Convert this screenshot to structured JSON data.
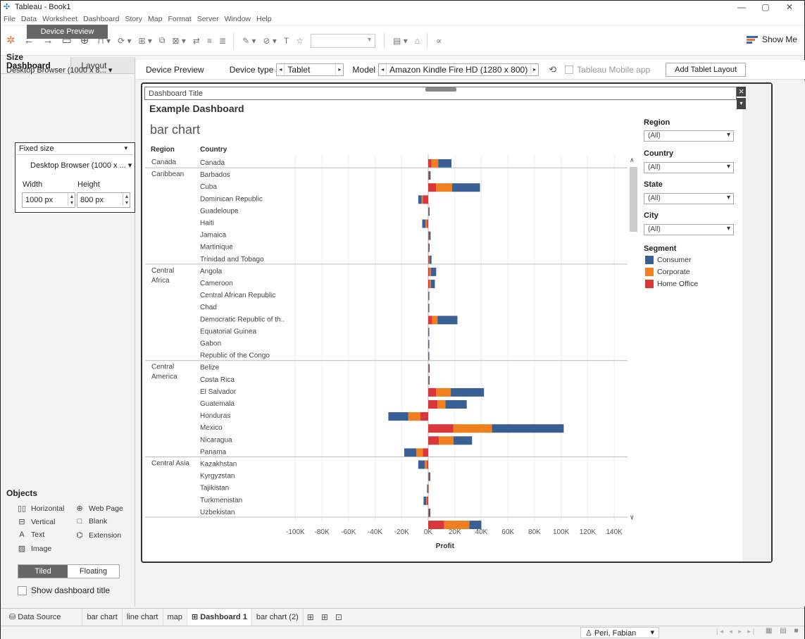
{
  "window": {
    "title": "Tableau - Book1",
    "minimize": "—",
    "restore": "▢",
    "close": "✕"
  },
  "menu": [
    "File",
    "Data",
    "Worksheet",
    "Dashboard",
    "Story",
    "Map",
    "Format",
    "Server",
    "Window",
    "Help"
  ],
  "toolbar": {
    "show_me": "Show Me"
  },
  "left_panel": {
    "tabs": {
      "dashboard": "Dashboard",
      "layout": "Layout"
    },
    "device_preview_button": "Device Preview",
    "size_title": "Size",
    "size_select": "Desktop Browser (1000 x 8... ▾",
    "fixed_size": "Fixed size",
    "desktop_browser": "Desktop Browser (1000 x ... ▾",
    "width_label": "Width",
    "height_label": "Height",
    "width_value": "1000 px",
    "height_value": "800 px",
    "objects_title": "Objects",
    "objects": {
      "horizontal": "Horizontal",
      "web_page": "Web Page",
      "vertical": "Vertical",
      "blank": "Blank",
      "text": "Text",
      "extension": "Extension",
      "image": "Image"
    },
    "tiled": "Tiled",
    "floating": "Floating",
    "show_dashboard_title": "Show dashboard title"
  },
  "device_bar": {
    "device_preview": "Device Preview",
    "device_type_label": "Device type",
    "device_type_value": "Tablet",
    "model_label": "Model",
    "model_value": "Amazon Kindle Fire HD (1280 x 800)",
    "mobile_app": "Tableau Mobile app",
    "add_layout": "Add Tablet Layout"
  },
  "dashboard": {
    "title_object": "Dashboard Title",
    "title": "Example Dashboard",
    "sheet_title": "bar chart",
    "header_region": "Region",
    "header_country": "Country",
    "axis_title": "Profit"
  },
  "filters": {
    "region": {
      "label": "Region",
      "value": "(All)"
    },
    "country": {
      "label": "Country",
      "value": "(All)"
    },
    "state": {
      "label": "State",
      "value": "(All)"
    },
    "city": {
      "label": "City",
      "value": "(All)"
    }
  },
  "legend": {
    "title": "Segment",
    "items": [
      {
        "label": "Consumer",
        "color": "#3a5f94"
      },
      {
        "label": "Corporate",
        "color": "#f0801f"
      },
      {
        "label": "Home Office",
        "color": "#d9373a"
      }
    ]
  },
  "chart_data": {
    "type": "bar",
    "orientation": "horizontal",
    "stacked": true,
    "xlabel": "Profit",
    "xlim": [
      -100000,
      150000
    ],
    "xticks": [
      "-100K",
      "-80K",
      "-60K",
      "-40K",
      "-20K",
      "0K",
      "20K",
      "40K",
      "60K",
      "80K",
      "100K",
      "120K",
      "140K"
    ],
    "series_names": [
      "Home Office",
      "Corporate",
      "Consumer"
    ],
    "colors": {
      "Home Office": "#d9373a",
      "Corporate": "#f0801f",
      "Consumer": "#3a5f94"
    },
    "groups": [
      {
        "region": "Canada",
        "rows": [
          {
            "country": "Canada",
            "values": [
              2500,
              5000,
              10000
            ]
          }
        ]
      },
      {
        "region": "Caribbean",
        "rows": [
          {
            "country": "Barbados",
            "values": [
              300,
              300,
              1200
            ]
          },
          {
            "country": "Cuba",
            "values": [
              6000,
              12000,
              21000
            ]
          },
          {
            "country": "Dominican Republic",
            "values": [
              -4000,
              -1000,
              -2500
            ]
          },
          {
            "country": "Guadeloupe",
            "values": [
              200,
              200,
              500
            ]
          },
          {
            "country": "Haiti",
            "values": [
              -1000,
              -1000,
              -2500
            ]
          },
          {
            "country": "Jamaica",
            "values": [
              300,
              300,
              1200
            ]
          },
          {
            "country": "Martinique",
            "values": [
              200,
              200,
              600
            ]
          },
          {
            "country": "Trinidad and Tobago",
            "values": [
              500,
              500,
              1500
            ]
          }
        ]
      },
      {
        "region": "Central Africa",
        "rows": [
          {
            "country": "Angola",
            "values": [
              1000,
              1000,
              4000
            ]
          },
          {
            "country": "Cameroon",
            "values": [
              1000,
              1000,
              3000
            ]
          },
          {
            "country": "Central African Republic",
            "values": [
              100,
              100,
              300
            ]
          },
          {
            "country": "Chad",
            "values": [
              100,
              100,
              400
            ]
          },
          {
            "country": "Democratic Republic of th..",
            "values": [
              3000,
              4000,
              15000
            ]
          },
          {
            "country": "Equatorial Guinea",
            "values": [
              100,
              100,
              400
            ]
          },
          {
            "country": "Gabon",
            "values": [
              100,
              100,
              400
            ]
          },
          {
            "country": "Republic of the Congo",
            "values": [
              100,
              100,
              500
            ]
          }
        ]
      },
      {
        "region": "Central America",
        "rows": [
          {
            "country": "Belize",
            "values": [
              200,
              300,
              300
            ]
          },
          {
            "country": "Costa Rica",
            "values": [
              200,
              200,
              500
            ]
          },
          {
            "country": "El Salvador",
            "values": [
              6000,
              11000,
              25000
            ]
          },
          {
            "country": "Guatemala",
            "values": [
              7000,
              6000,
              16000
            ]
          },
          {
            "country": "Honduras",
            "values": [
              -6000,
              -9000,
              -15000
            ]
          },
          {
            "country": "Mexico",
            "values": [
              19000,
              29000,
              54000
            ]
          },
          {
            "country": "Nicaragua",
            "values": [
              8000,
              11000,
              14000
            ]
          },
          {
            "country": "Panama",
            "values": [
              -4000,
              -5000,
              -9000
            ]
          }
        ]
      },
      {
        "region": "Central Asia",
        "rows": [
          {
            "country": "Kazakhstan",
            "values": [
              -1000,
              -1500,
              -5000
            ]
          },
          {
            "country": "Kyrgyzstan",
            "values": [
              300,
              300,
              1000
            ]
          },
          {
            "country": "Tajikistan",
            "values": [
              -200,
              -200,
              -500
            ]
          },
          {
            "country": "Turkmenistan",
            "values": [
              -1000,
              -500,
              -2000
            ]
          },
          {
            "country": "Uzbekistan",
            "values": [
              300,
              300,
              1000
            ]
          }
        ]
      },
      {
        "region": "",
        "rows": [
          {
            "country": "",
            "values": [
              12000,
              19000,
              9000
            ]
          }
        ]
      }
    ]
  },
  "sheet_tabs": {
    "data_source": "Data Source",
    "tabs": [
      "bar chart",
      "line chart",
      "map",
      "Dashboard 1",
      "bar chart (2)"
    ],
    "active": "Dashboard 1"
  },
  "status": {
    "user": "Peri, Fabian"
  }
}
